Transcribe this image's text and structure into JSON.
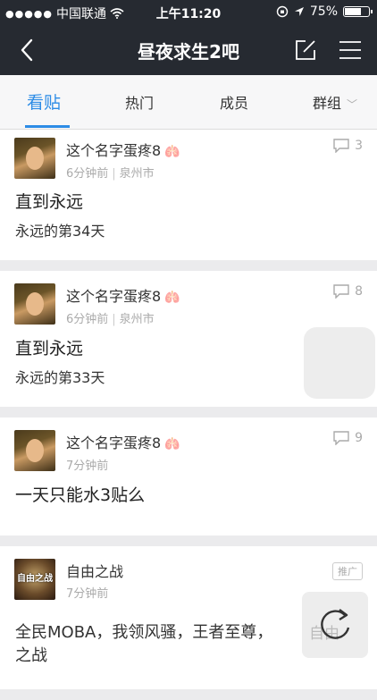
{
  "status_bar": {
    "carrier": "中国联通",
    "time": "上午11:20",
    "battery": "75%",
    "battery_level": 0.75
  },
  "nav": {
    "title": "昼夜求生2吧",
    "back_icon": "chevron-left-icon",
    "edit_icon": "compose-icon",
    "menu_icon": "hamburger-icon"
  },
  "tabs": [
    {
      "label": "看贴",
      "active": true
    },
    {
      "label": "热门",
      "active": false
    },
    {
      "label": "成员",
      "active": false
    },
    {
      "label": "群组",
      "active": false
    }
  ],
  "posts": [
    {
      "author": "这个名字蛋疼8",
      "time": "6分钟前",
      "location": "泉州市",
      "comments": "3",
      "title": "直到永远",
      "body": "永远的第34天"
    },
    {
      "author": "这个名字蛋疼8",
      "time": "6分钟前",
      "location": "泉州市",
      "comments": "8",
      "title": "直到永远",
      "body": "永远的第33天"
    },
    {
      "author": "这个名字蛋疼8",
      "time": "7分钟前",
      "comments": "9",
      "title": "一天只能水3贴么"
    }
  ],
  "ad": {
    "author": "自由之战",
    "time": "7分钟前",
    "badge": "推广",
    "avatar_text": "自由之战",
    "body_line1": "全民MOBA，我领风骚，王者至尊，",
    "body_line2": "之战",
    "overlay_fragment": "自由"
  }
}
